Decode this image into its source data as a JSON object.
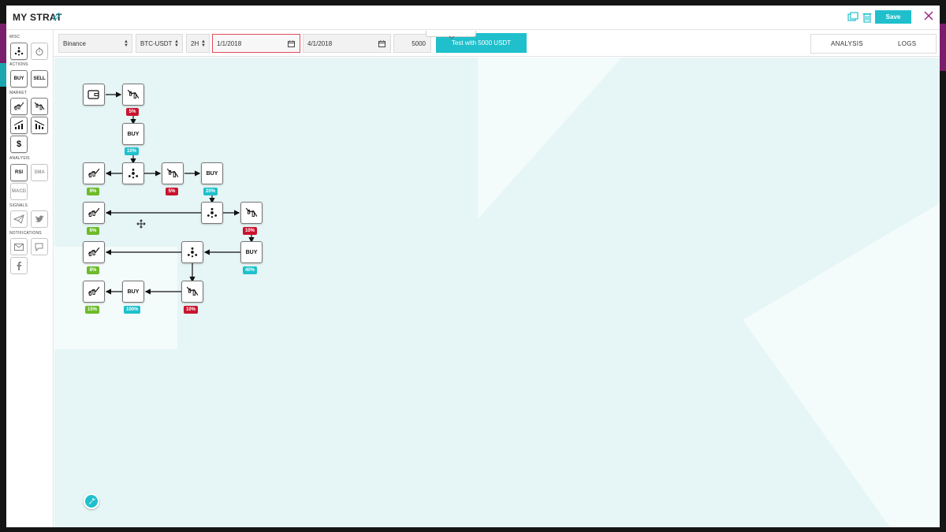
{
  "header": {
    "title": "MY STRAT",
    "save_label": "Save"
  },
  "sidebar": {
    "sections": {
      "misc": "MISC",
      "actions": "ACTIONS",
      "market": "MARKET",
      "analysis": "ANALYSIS",
      "signals": "SIGNALS",
      "notifications": "NOTIFICATIONS"
    },
    "actions": {
      "buy": "BUY",
      "sell": "SELL"
    },
    "market_dollar": "$",
    "analysis": {
      "rsi": "RSI",
      "sma": "SMA",
      "macd": "MACD"
    }
  },
  "controls": {
    "exchange": "Binance",
    "pair": "BTC-USDT",
    "interval": "2H",
    "start_date": "1/1/2018",
    "end_date": "4/1/2018",
    "amount": "5000",
    "test_label": "Test with 5000 USDT"
  },
  "tabs": {
    "analysis": "ANALYSIS",
    "logs": "LOGS"
  },
  "flow": {
    "nodes": [
      {
        "id": "wallet",
        "kind": "wallet-icon",
        "label": ""
      },
      {
        "id": "m1",
        "kind": "market-down-icon",
        "label": ""
      },
      {
        "id": "buy1",
        "kind": "buy",
        "label": "BUY"
      },
      {
        "id": "split1",
        "kind": "split-icon",
        "label": ""
      },
      {
        "id": "up1",
        "kind": "market-up-icon",
        "label": ""
      },
      {
        "id": "m2",
        "kind": "market-down-icon",
        "label": ""
      },
      {
        "id": "buy2",
        "kind": "buy",
        "label": "BUY"
      },
      {
        "id": "up2",
        "kind": "market-up-icon",
        "label": ""
      },
      {
        "id": "split2",
        "kind": "split-icon",
        "label": ""
      },
      {
        "id": "m3",
        "kind": "market-down-icon",
        "label": ""
      },
      {
        "id": "up3",
        "kind": "market-up-icon",
        "label": ""
      },
      {
        "id": "split3",
        "kind": "split-icon",
        "label": ""
      },
      {
        "id": "buy3",
        "kind": "buy",
        "label": "BUY"
      },
      {
        "id": "up4",
        "kind": "market-up-icon",
        "label": ""
      },
      {
        "id": "buy4",
        "kind": "buy",
        "label": "BUY"
      },
      {
        "id": "m4",
        "kind": "market-down-icon",
        "label": ""
      }
    ],
    "badges": {
      "m1": "5%",
      "buy1": "10%",
      "up1": "9%",
      "m2": "5%",
      "buy2": "20%",
      "up2": "6%",
      "m3": "10%",
      "up3": "8%",
      "buy3": "40%",
      "up4": "15%",
      "buy4": "100%",
      "m4": "10%"
    }
  },
  "colors": {
    "accent": "#1fc0cc",
    "danger": "#c9142e",
    "success": "#6cbb2a",
    "canvas": "#e6f5f5"
  }
}
